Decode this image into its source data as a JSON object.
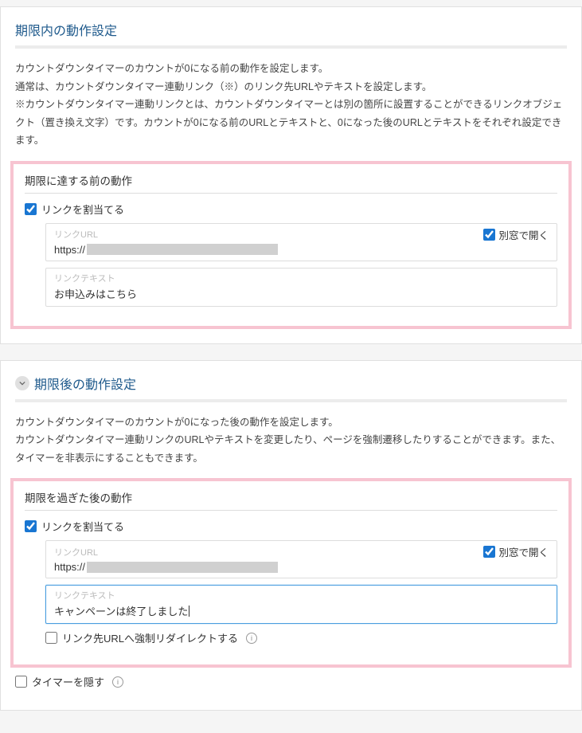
{
  "panel1": {
    "title": "期限内の動作設定",
    "desc_lines": [
      "カウントダウンタイマーのカウントが0になる前の動作を設定します。",
      "通常は、カウントダウンタイマー連動リンク（※）のリンク先URLやテキストを設定します。",
      "※カウントダウンタイマー連動リンクとは、カウントダウンタイマーとは別の箇所に設置することができるリンクオブジェクト（置き換え文字）です。カウントが0になる前のURLとテキストと、0になった後のURLとテキストをそれぞれ設定できます。"
    ],
    "sub_title": "期限に達する前の動作",
    "assign_link_label": "リンクを割当てる",
    "link_url_label": "リンクURL",
    "link_url_value": "https://",
    "new_window_label": "別窓で開く",
    "link_text_label": "リンクテキスト",
    "link_text_value": "お申込みはこちら"
  },
  "panel2": {
    "title": "期限後の動作設定",
    "desc_lines": [
      "カウントダウンタイマーのカウントが0になった後の動作を設定します。",
      "カウントダウンタイマー連動リンクのURLやテキストを変更したり、ページを強制遷移したりすることができます。また、タイマーを非表示にすることもできます。"
    ],
    "sub_title": "期限を過ぎた後の動作",
    "assign_link_label": "リンクを割当てる",
    "link_url_label": "リンクURL",
    "link_url_value": "https://",
    "new_window_label": "別窓で開く",
    "link_text_label": "リンクテキスト",
    "link_text_value": "キャンペーンは終了しました",
    "force_redirect_label": "リンク先URLへ強制リダイレクトする",
    "hide_timer_label": "タイマーを隠す"
  }
}
